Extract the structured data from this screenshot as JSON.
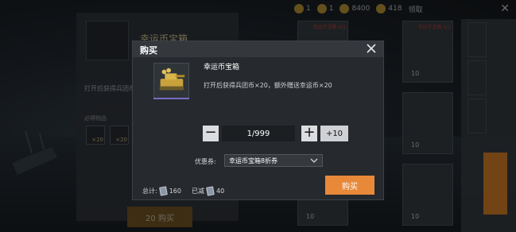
{
  "top_bar": {
    "resources": [
      {
        "value": "1"
      },
      {
        "value": "1"
      },
      {
        "value": "8400"
      },
      {
        "value": "418"
      }
    ],
    "label": "领取"
  },
  "background_panel": {
    "title": "幸运币宝箱",
    "description": "打开后获得兵团币",
    "sub_label": "必得物品",
    "reward_counts": [
      "×20",
      "×20"
    ],
    "button_label": "20 购买"
  },
  "shop_grid": {
    "cards": [
      {
        "tag": "幸运币宝箱 0/1",
        "count": ""
      },
      {
        "tag": "幸运币宝箱 0/1",
        "count": "10"
      },
      {
        "tag": "",
        "count": "10"
      },
      {
        "tag": "",
        "count": "10"
      },
      {
        "tag": "",
        "count": "10"
      },
      {
        "tag": "",
        "count": "10"
      }
    ]
  },
  "right_rail": {
    "items": [
      "",
      "",
      "",
      ""
    ],
    "highlight_label": ""
  },
  "dialog": {
    "title": "购买",
    "item_name": "幸运币宝箱",
    "item_description": "打开后获得兵团币×20，额外赠送幸运币×20",
    "quantity_minus": "−",
    "quantity_value": "1/999",
    "quantity_plus": "+",
    "quantity_plus10": "+10",
    "coupon_label": "优惠券:",
    "coupon_selected": "幸运币宝箱8折券",
    "total_label": "总计:",
    "total_value": "160",
    "discount_label": "已减",
    "discount_value": "40",
    "buy_label": "购买"
  },
  "colors": {
    "accent_orange": "#e8893a",
    "rarity_bar": "#7b6cc7",
    "dialog_bg": "#26292d"
  }
}
